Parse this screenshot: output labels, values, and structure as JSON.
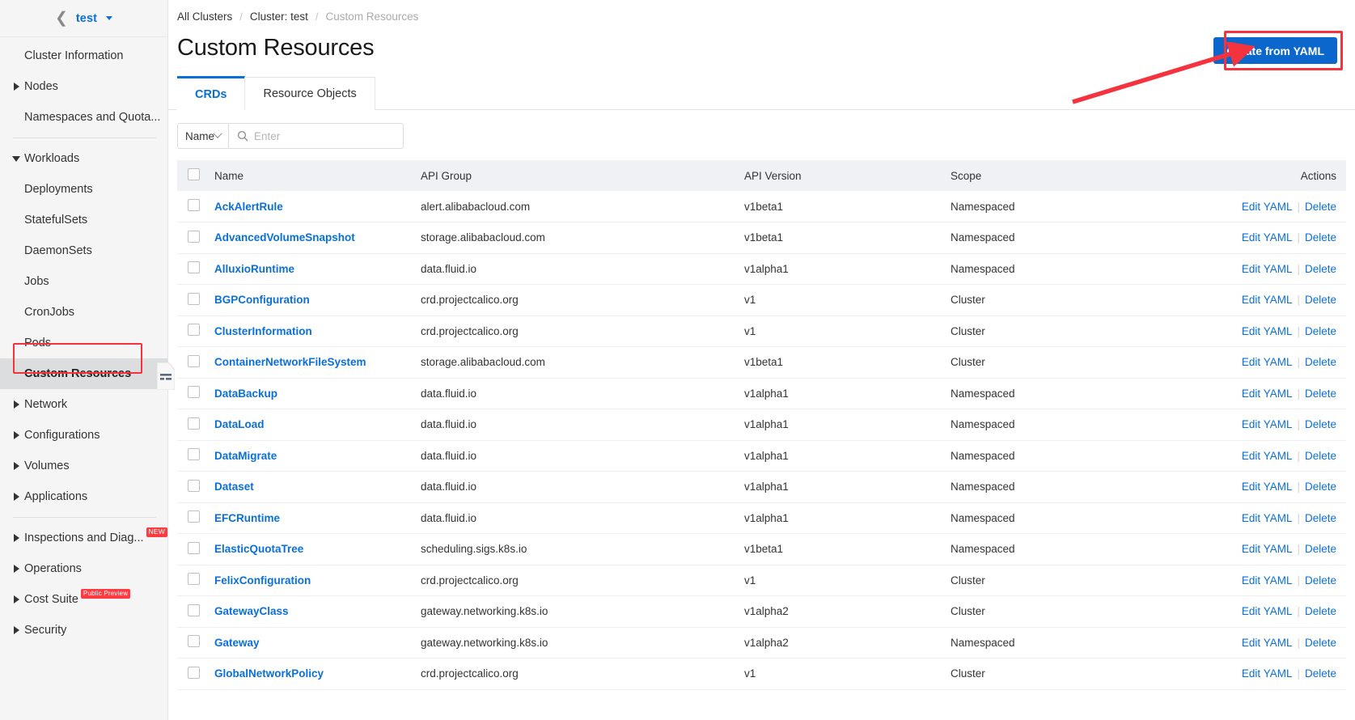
{
  "sidebar": {
    "cluster": {
      "back_icon": "chevron-left-icon",
      "name": "test",
      "caret_icon": "caret-down-icon"
    },
    "items": [
      {
        "label": "Cluster Information",
        "type": "leaf"
      },
      {
        "label": "Nodes",
        "type": "group",
        "expanded": false
      },
      {
        "label": "Namespaces and Quota...",
        "type": "leaf"
      },
      {
        "label": "Workloads",
        "type": "group",
        "expanded": true
      },
      {
        "label": "Deployments",
        "type": "child"
      },
      {
        "label": "StatefulSets",
        "type": "child"
      },
      {
        "label": "DaemonSets",
        "type": "child"
      },
      {
        "label": "Jobs",
        "type": "child"
      },
      {
        "label": "CronJobs",
        "type": "child"
      },
      {
        "label": "Pods",
        "type": "child"
      },
      {
        "label": "Custom Resources",
        "type": "child",
        "selected": true
      },
      {
        "label": "Network",
        "type": "group",
        "expanded": false
      },
      {
        "label": "Configurations",
        "type": "group",
        "expanded": false
      },
      {
        "label": "Volumes",
        "type": "group",
        "expanded": false
      },
      {
        "label": "Applications",
        "type": "group",
        "expanded": false
      },
      {
        "label": "Inspections and Diag...",
        "type": "group",
        "expanded": false,
        "badge": "NEW"
      },
      {
        "label": "Operations",
        "type": "group",
        "expanded": false
      },
      {
        "label": "Cost Suite",
        "type": "group",
        "expanded": false,
        "badge": "Public Preview"
      },
      {
        "label": "Security",
        "type": "group",
        "expanded": false
      }
    ],
    "collapse_handle_icon": "collapse-panel-icon"
  },
  "breadcrumb": {
    "all_clusters": "All Clusters",
    "sep1": "/",
    "cluster": "Cluster: test",
    "sep2": "/",
    "current": "Custom Resources"
  },
  "header": {
    "title": "Custom Resources",
    "create_button": "Create from YAML"
  },
  "tabs": [
    {
      "label": "CRDs",
      "active": true
    },
    {
      "label": "Resource Objects",
      "active": false
    }
  ],
  "filter": {
    "select_value": "Name",
    "search_placeholder": "Enter",
    "search_value": "",
    "search_icon": "search-icon",
    "chevron_icon": "chevron-down-icon"
  },
  "table": {
    "columns": [
      "Name",
      "API Group",
      "API Version",
      "Scope",
      "Actions"
    ],
    "actions": {
      "edit": "Edit YAML",
      "separator": "|",
      "delete": "Delete"
    },
    "rows": [
      {
        "name": "AckAlertRule",
        "group": "alert.alibabacloud.com",
        "version": "v1beta1",
        "scope": "Namespaced"
      },
      {
        "name": "AdvancedVolumeSnapshot",
        "group": "storage.alibabacloud.com",
        "version": "v1beta1",
        "scope": "Namespaced"
      },
      {
        "name": "AlluxioRuntime",
        "group": "data.fluid.io",
        "version": "v1alpha1",
        "scope": "Namespaced"
      },
      {
        "name": "BGPConfiguration",
        "group": "crd.projectcalico.org",
        "version": "v1",
        "scope": "Cluster"
      },
      {
        "name": "ClusterInformation",
        "group": "crd.projectcalico.org",
        "version": "v1",
        "scope": "Cluster"
      },
      {
        "name": "ContainerNetworkFileSystem",
        "group": "storage.alibabacloud.com",
        "version": "v1beta1",
        "scope": "Cluster"
      },
      {
        "name": "DataBackup",
        "group": "data.fluid.io",
        "version": "v1alpha1",
        "scope": "Namespaced"
      },
      {
        "name": "DataLoad",
        "group": "data.fluid.io",
        "version": "v1alpha1",
        "scope": "Namespaced"
      },
      {
        "name": "DataMigrate",
        "group": "data.fluid.io",
        "version": "v1alpha1",
        "scope": "Namespaced"
      },
      {
        "name": "Dataset",
        "group": "data.fluid.io",
        "version": "v1alpha1",
        "scope": "Namespaced"
      },
      {
        "name": "EFCRuntime",
        "group": "data.fluid.io",
        "version": "v1alpha1",
        "scope": "Namespaced"
      },
      {
        "name": "ElasticQuotaTree",
        "group": "scheduling.sigs.k8s.io",
        "version": "v1beta1",
        "scope": "Namespaced"
      },
      {
        "name": "FelixConfiguration",
        "group": "crd.projectcalico.org",
        "version": "v1",
        "scope": "Cluster"
      },
      {
        "name": "GatewayClass",
        "group": "gateway.networking.k8s.io",
        "version": "v1alpha2",
        "scope": "Cluster"
      },
      {
        "name": "Gateway",
        "group": "gateway.networking.k8s.io",
        "version": "v1alpha2",
        "scope": "Namespaced"
      },
      {
        "name": "GlobalNetworkPolicy",
        "group": "crd.projectcalico.org",
        "version": "v1",
        "scope": "Cluster"
      }
    ]
  },
  "annotations": {
    "highlight_color": "#f5333f",
    "targets": [
      "create-from-yaml-button",
      "sidebar-item-custom-resources"
    ]
  },
  "colors": {
    "accent": "#0a6fd8",
    "primary_button": "#0c67cc",
    "table_header_bg": "#eff1f5",
    "sidebar_bg": "#f5f5f5",
    "badge_red": "#ff3b41"
  }
}
